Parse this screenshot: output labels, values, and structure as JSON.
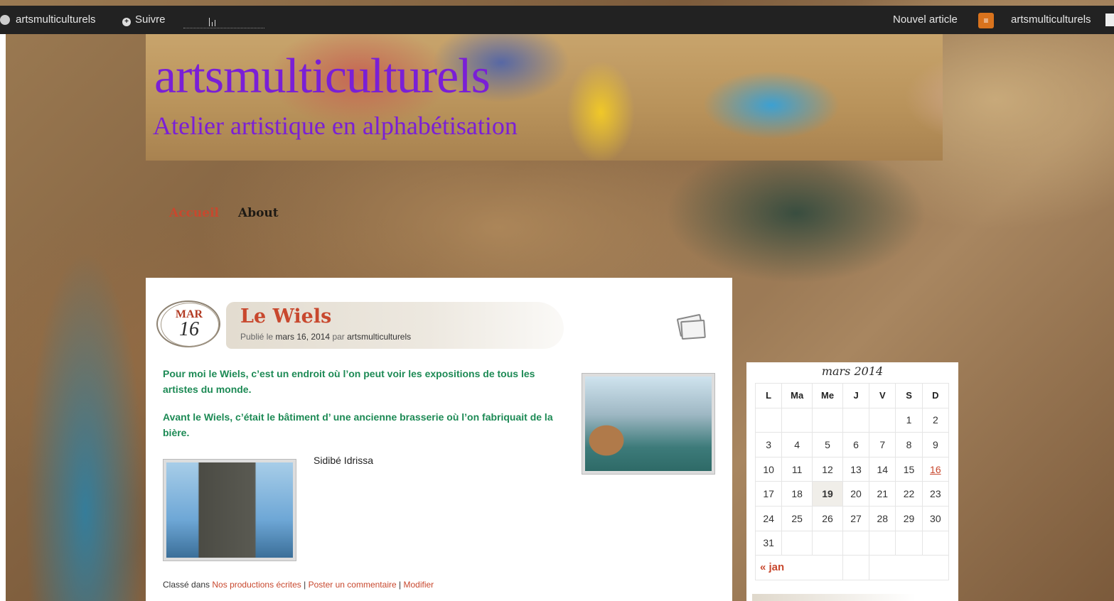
{
  "admin_bar": {
    "site_name": "artsmulticulturels",
    "follow_label": "Suivre",
    "new_post_label": "Nouvel article",
    "user_name": "artsmulticulturels"
  },
  "header": {
    "site_title": "artsmulticulturels",
    "site_description": "Atelier artistique en alphabétisation"
  },
  "nav": {
    "items": [
      {
        "label": "Accueil"
      },
      {
        "label": "About"
      }
    ]
  },
  "post": {
    "date": {
      "month": "MAR",
      "day": "16"
    },
    "title": "Le Wiels",
    "meta_prefix": "Publié le",
    "meta_date": "mars 16, 2014",
    "meta_by": "par",
    "meta_author": "artsmulticulturels",
    "paragraphs": [
      "Pour moi le Wiels, c’est un endroit où l’on peut voir les expositions de tous les artistes du monde.",
      "Avant le Wiels, c’était le bâtiment d’ une ancienne brasserie où l’on fabriquait de la bière."
    ],
    "author_name": "Sidibé Idrissa",
    "footer": {
      "filed_in": "Classé dans",
      "category": "Nos productions écrites",
      "sep": "|",
      "comment": "Poster un commentaire",
      "edit": "Modifier"
    }
  },
  "calendar": {
    "caption": "mars 2014",
    "headers": [
      "L",
      "Ma",
      "Me",
      "J",
      "V",
      "S",
      "D"
    ],
    "rows": [
      [
        "",
        "",
        "",
        "",
        "",
        "1",
        "2"
      ],
      [
        "3",
        "4",
        "5",
        "6",
        "7",
        "8",
        "9"
      ],
      [
        "10",
        "11",
        "12",
        "13",
        "14",
        "15",
        "16"
      ],
      [
        "17",
        "18",
        "19",
        "20",
        "21",
        "22",
        "23"
      ],
      [
        "24",
        "25",
        "26",
        "27",
        "28",
        "29",
        "30"
      ],
      [
        "31",
        "",
        "",
        "",
        "",
        "",
        ""
      ]
    ],
    "prev_link": "« jan",
    "today": "19",
    "linked_day": "16"
  },
  "colors": {
    "accent": "#c8482e",
    "title_purple": "#7a1fd6",
    "body_green": "#1d8a55",
    "admin_bar": "#222222"
  }
}
